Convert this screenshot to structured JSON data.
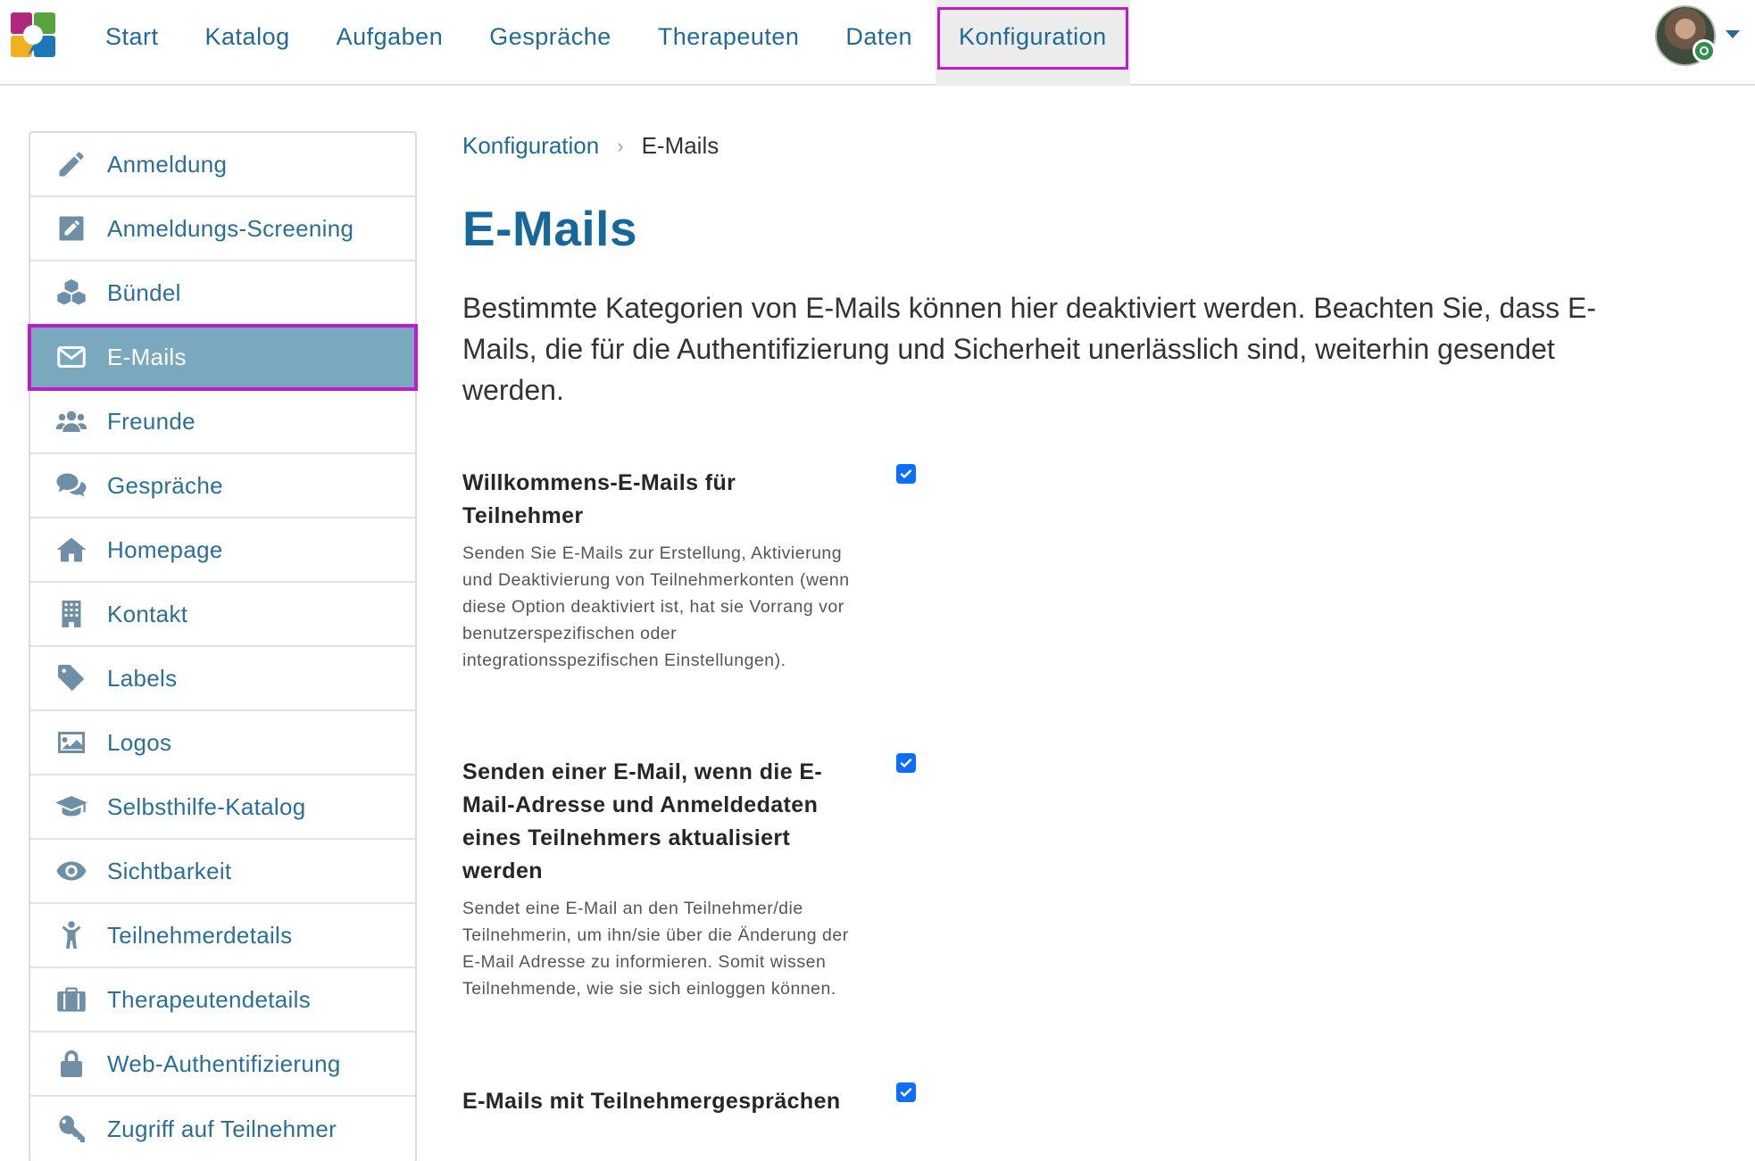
{
  "nav": {
    "items": [
      {
        "label": "Start"
      },
      {
        "label": "Katalog"
      },
      {
        "label": "Aufgaben"
      },
      {
        "label": "Gespräche"
      },
      {
        "label": "Therapeuten"
      },
      {
        "label": "Daten"
      },
      {
        "label": "Konfiguration",
        "active": true
      }
    ]
  },
  "sidebar": {
    "items": [
      {
        "label": "Anmeldung",
        "icon": "pencil-icon"
      },
      {
        "label": "Anmeldungs-Screening",
        "icon": "edit-square-icon"
      },
      {
        "label": "Bündel",
        "icon": "cubes-icon"
      },
      {
        "label": "E-Mails",
        "icon": "envelope-icon",
        "active": true
      },
      {
        "label": "Freunde",
        "icon": "users-icon"
      },
      {
        "label": "Gespräche",
        "icon": "comments-icon"
      },
      {
        "label": "Homepage",
        "icon": "home-icon"
      },
      {
        "label": "Kontakt",
        "icon": "building-icon"
      },
      {
        "label": "Labels",
        "icon": "tag-icon"
      },
      {
        "label": "Logos",
        "icon": "image-icon"
      },
      {
        "label": "Selbsthilfe-Katalog",
        "icon": "graduation-cap-icon"
      },
      {
        "label": "Sichtbarkeit",
        "icon": "eye-icon"
      },
      {
        "label": "Teilnehmerdetails",
        "icon": "child-icon"
      },
      {
        "label": "Therapeutendetails",
        "icon": "briefcase-icon"
      },
      {
        "label": "Web-Authentifizierung",
        "icon": "lock-icon"
      },
      {
        "label": "Zugriff auf Teilnehmer",
        "icon": "key-icon"
      }
    ]
  },
  "breadcrumb": {
    "parent": "Konfiguration",
    "current": "E-Mails"
  },
  "page": {
    "title": "E-Mails",
    "intro": "Bestimmte Kategorien von E-Mails können hier deaktiviert werden. Beachten Sie, dass E-Mails, die für die Authentifizierung und Sicherheit unerlässlich sind, weiterhin gesendet werden."
  },
  "settings": [
    {
      "title": "Willkommens-E-Mails für Teilnehmer",
      "description": "Senden Sie E-Mails zur Erstellung, Aktivierung und Deaktivierung von Teilnehmerkonten (wenn diese Option deaktiviert ist, hat sie Vorrang vor benutzerspezifischen oder integrationsspezifischen Einstellungen).",
      "checked": true
    },
    {
      "title": "Senden einer E-Mail, wenn die E-Mail-Adresse und Anmeldedaten eines Teilnehmers aktualisiert werden",
      "description": "Sendet eine E-Mail an den Teilnehmer/die Teilnehmerin, um ihn/sie über die Änderung der E-Mail Adresse zu informieren. Somit wissen Teilnehmende, wie sie sich einloggen können.",
      "checked": true
    },
    {
      "title": "E-Mails mit Teilnehmergesprächen",
      "description": "",
      "checked": true
    }
  ],
  "colors": {
    "link": "#1f6a96",
    "title": "#16679a",
    "active_sidebar": "#7aa9bf",
    "highlight": "#c01bc9",
    "checkbox": "#0d6efd"
  }
}
